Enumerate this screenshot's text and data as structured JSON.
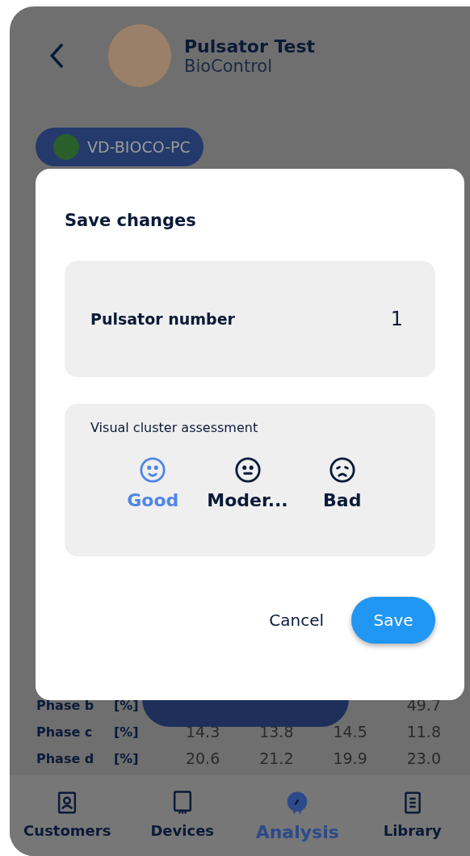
{
  "header": {
    "title": "Pulsator Test",
    "subtitle": "BioControl"
  },
  "device_chip": {
    "label": "VD-BIOCO-PC",
    "color": "#2a5e2a"
  },
  "table": {
    "rows": [
      {
        "label": "Phase b",
        "unit": "[%]",
        "values": [
          "49.7"
        ]
      },
      {
        "label": "Phase c",
        "unit": "[%]",
        "values": [
          "14.3",
          "13.8",
          "14.5",
          "11.8"
        ]
      },
      {
        "label": "Phase d",
        "unit": "[%]",
        "values": [
          "20.6",
          "21.2",
          "19.9",
          "23.0"
        ]
      }
    ]
  },
  "dialog": {
    "title": "Save changes",
    "field": {
      "label": "Pulsator number",
      "value": "1"
    },
    "assessment": {
      "label": "Visual cluster assessment",
      "options": [
        {
          "kind": "good",
          "label": "Good",
          "selected": true
        },
        {
          "kind": "moderate",
          "label": "Moder...",
          "selected": false
        },
        {
          "kind": "bad",
          "label": "Bad",
          "selected": false
        }
      ]
    },
    "buttons": {
      "cancel": "Cancel",
      "save": "Save"
    }
  },
  "nav": [
    {
      "kind": "customers",
      "label": "Customers",
      "selected": false
    },
    {
      "kind": "devices",
      "label": "Devices",
      "selected": false
    },
    {
      "kind": "analysis",
      "label": "Analysis",
      "selected": true
    },
    {
      "kind": "library",
      "label": "Library",
      "selected": false
    }
  ]
}
